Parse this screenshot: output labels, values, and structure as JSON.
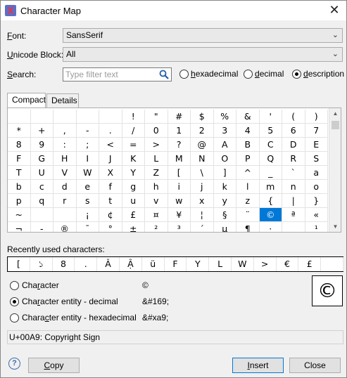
{
  "window": {
    "title": "Character Map"
  },
  "font": {
    "label_u": "F",
    "label_rest": "ont:",
    "value": "SansSerif"
  },
  "block": {
    "label_u": "U",
    "label_rest": "nicode Block:",
    "value": "All"
  },
  "search": {
    "label_u": "S",
    "label_rest": "earch:",
    "placeholder": "Type filter text",
    "options": [
      {
        "u": "h",
        "rest": "exadecimal",
        "selected": false
      },
      {
        "u": "d",
        "rest": "ecimal",
        "selected": false
      },
      {
        "u": "d",
        "rest": "escription",
        "selected": true
      }
    ]
  },
  "tabs": {
    "compact": "Compact",
    "details": "Details"
  },
  "grid": {
    "rows": [
      [
        "",
        "",
        "",
        "",
        "",
        "!",
        "\"",
        "#",
        "$",
        "%",
        "&",
        "'",
        "(",
        ")"
      ],
      [
        "*",
        "+",
        ",",
        "-",
        ".",
        "/",
        "0",
        "1",
        "2",
        "3",
        "4",
        "5",
        "6",
        "7"
      ],
      [
        "8",
        "9",
        ":",
        ";",
        "<",
        "=",
        ">",
        "?",
        "@",
        "A",
        "B",
        "C",
        "D",
        "E"
      ],
      [
        "F",
        "G",
        "H",
        "I",
        "J",
        "K",
        "L",
        "M",
        "N",
        "O",
        "P",
        "Q",
        "R",
        "S"
      ],
      [
        "T",
        "U",
        "V",
        "W",
        "X",
        "Y",
        "Z",
        "[",
        "\\",
        "]",
        "^",
        "_",
        "`",
        "a"
      ],
      [
        "b",
        "c",
        "d",
        "e",
        "f",
        "g",
        "h",
        "i",
        "j",
        "k",
        "l",
        "m",
        "n",
        "o"
      ],
      [
        "p",
        "q",
        "r",
        "s",
        "t",
        "u",
        "v",
        "w",
        "x",
        "y",
        "z",
        "{",
        "|",
        "}"
      ],
      [
        "~",
        "",
        "",
        "¡",
        "¢",
        "£",
        "¤",
        "¥",
        "¦",
        "§",
        "¨",
        "©",
        "ª",
        "«"
      ],
      [
        "¬",
        "-",
        "®",
        "¯",
        "°",
        "±",
        "²",
        "³",
        "´",
        "µ",
        "¶",
        "·",
        "¸",
        "¹"
      ]
    ],
    "selected": "©"
  },
  "recent": {
    "label": "Recently used characters:",
    "chars": [
      "[",
      "১",
      "8",
      ".",
      "Â",
      "Ậ",
      "ü",
      "F",
      "Y",
      "L",
      "W",
      ">",
      "€",
      "£",
      ""
    ]
  },
  "output": {
    "options": [
      {
        "pre": "Cha",
        "u": "r",
        "post": "acter",
        "value": "©",
        "selected": false
      },
      {
        "pre": "Cha",
        "u": "r",
        "post": "acter entity - decimal",
        "value": "&#169;",
        "selected": true
      },
      {
        "pre": "Chara",
        "u": "c",
        "post": "ter entity - hexadecimal",
        "value": "&#xa9;",
        "selected": false
      }
    ],
    "preview": "©"
  },
  "status": {
    "text": "U+00A9: Copyright Sign"
  },
  "buttons": {
    "help": "?",
    "copy_u": "C",
    "copy_rest": "opy",
    "insert_u": "I",
    "insert_rest": "nsert",
    "close": "Close"
  }
}
